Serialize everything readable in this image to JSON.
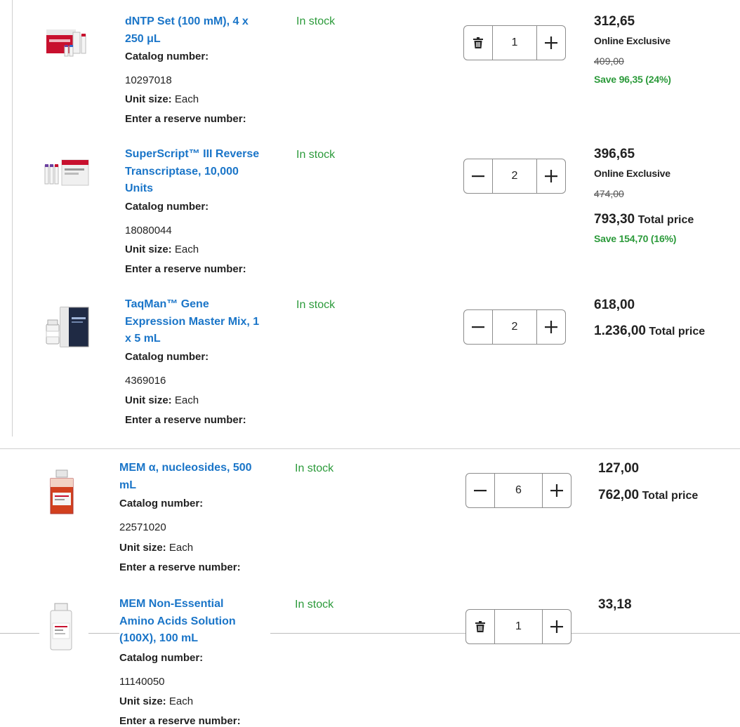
{
  "labels": {
    "catalog": "Catalog number:",
    "unit_size": "Unit size:",
    "reserve": "Enter a reserve number:",
    "total_price": "Total price"
  },
  "items": [
    {
      "name_lines": [
        "dNTP Set (100 mM), 4 x",
        "250 μL"
      ],
      "stock": "In stock",
      "catalog_number": "10297018",
      "unit_size": "Each",
      "quantity": "1",
      "decrement_icon": "trash-icon",
      "price": "312,65",
      "online_exclusive": "Online Exclusive",
      "list_price": "409,00",
      "savings": "Save 96,35 (24%)"
    },
    {
      "name_lines": [
        "SuperScript™ III Reverse",
        "Transcriptase, 10,000",
        "Units"
      ],
      "stock": "In stock",
      "catalog_number": "18080044",
      "unit_size": "Each",
      "quantity": "2",
      "decrement_icon": "minus-icon",
      "price": "396,65",
      "online_exclusive": "Online Exclusive",
      "list_price": "474,00",
      "total_price": "793,30",
      "savings": "Save 154,70 (16%)"
    },
    {
      "name_lines": [
        "TaqMan™ Gene",
        "Expression Master Mix, 1",
        "x 5 mL"
      ],
      "stock": "In stock",
      "catalog_number": "4369016",
      "unit_size": "Each",
      "quantity": "2",
      "decrement_icon": "minus-icon",
      "price": "618,00",
      "total_price": "1.236,00"
    },
    {
      "name_lines": [
        "MEM α, nucleosides, 500",
        "mL"
      ],
      "stock": "In stock",
      "catalog_number": "22571020",
      "unit_size": "Each",
      "quantity": "6",
      "decrement_icon": "minus-icon",
      "price": "127,00",
      "total_price": "762,00"
    },
    {
      "name_lines": [
        "MEM Non-Essential",
        "Amino Acids Solution",
        "(100X), 100 mL"
      ],
      "stock": "In stock",
      "catalog_number": "11140050",
      "unit_size": "Each",
      "quantity": "1",
      "decrement_icon": "trash-icon",
      "price": "33,18"
    }
  ]
}
